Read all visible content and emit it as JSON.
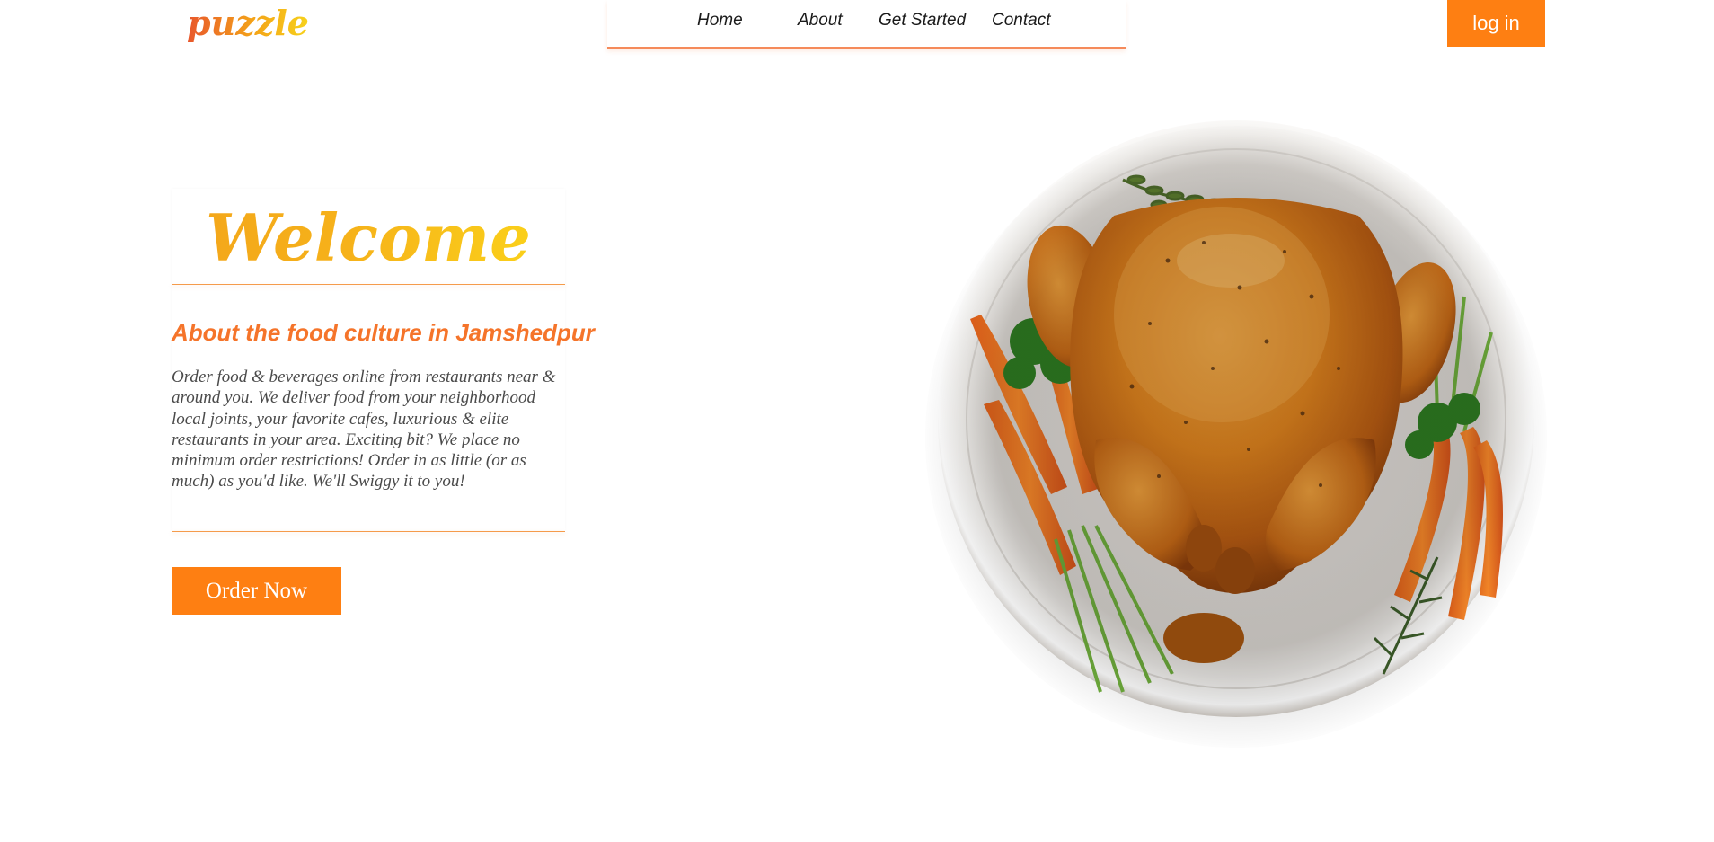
{
  "header": {
    "logo": "puzzle",
    "nav": {
      "home": "Home",
      "about": "About",
      "get_started": "Get Started",
      "contact": "Contact"
    },
    "login_label": "log in"
  },
  "hero": {
    "welcome": "Welcome",
    "about_title": "About the food culture in Jamshedpur",
    "about_text": "Order food & beverages online from restaurants near & around you. We deliver food from your neighborhood local joints, your favorite cafes, luxurious & elite restaurants in your area. Exciting bit? We place no minimum order restrictions! Order in as little (or as much) as you'd like. We'll Swiggy it to you!",
    "order_label": "Order Now"
  },
  "image": {
    "name": "roast-chicken-plate"
  },
  "colors": {
    "accent": "#fe7f12",
    "heading": "#f5742a",
    "welcome_gradient_start": "#f3a51b",
    "welcome_gradient_end": "#fbd51a"
  }
}
